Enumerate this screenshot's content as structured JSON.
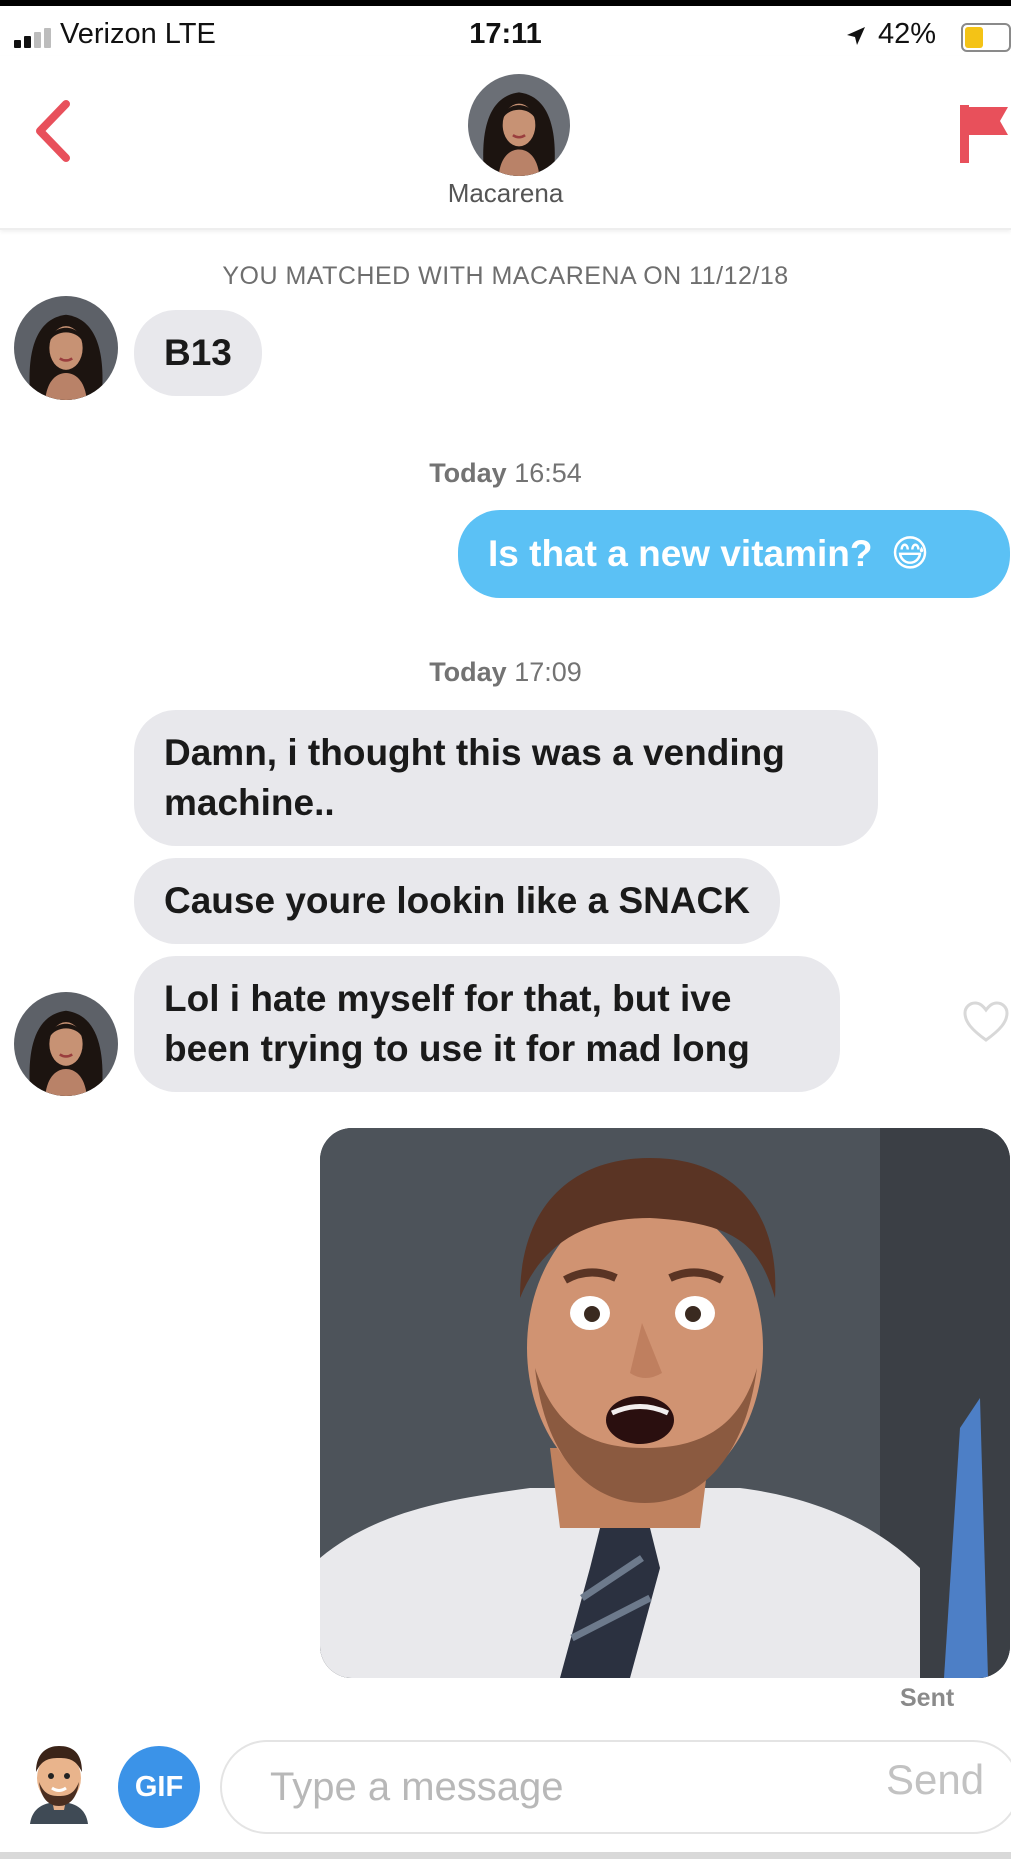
{
  "status_bar": {
    "carrier": "Verizon  LTE",
    "time": "17:11",
    "battery_percent": "42%",
    "battery_level": 0.42,
    "signal_bars": 2
  },
  "header": {
    "contact_name": "Macarena",
    "back_icon": "chevron-left-icon",
    "report_icon": "flag-icon",
    "accent_color": "#e8505b"
  },
  "conversation": {
    "match_note": "YOU MATCHED WITH MACARENA ON 11/12/18",
    "messages": [
      {
        "from": "them",
        "text": "B13"
      },
      {
        "from": "me",
        "text": "Is that a new vitamin?"
      },
      {
        "from": "them",
        "text_lines": [
          "Damn, i thought this was a vending",
          "machine.."
        ]
      },
      {
        "from": "them",
        "text": "Cause youre lookin like a SNACK"
      },
      {
        "from": "them",
        "text_lines": [
          "Lol i hate myself for that, but ive",
          "been trying to use it for mad long"
        ]
      },
      {
        "from": "me",
        "type": "gif"
      }
    ],
    "timestamps": [
      {
        "day": "Today",
        "time": "16:54"
      },
      {
        "day": "Today",
        "time": "17:09"
      }
    ],
    "outgoing_emoji": "😅",
    "sent_label": "Sent",
    "like_icon": "heart-outline-icon",
    "colors": {
      "incoming": "#e8e8ec",
      "outgoing": "#5bc1f5"
    }
  },
  "composer": {
    "gif_label": "GIF",
    "placeholder": "Type a message",
    "send_label": "Send"
  }
}
